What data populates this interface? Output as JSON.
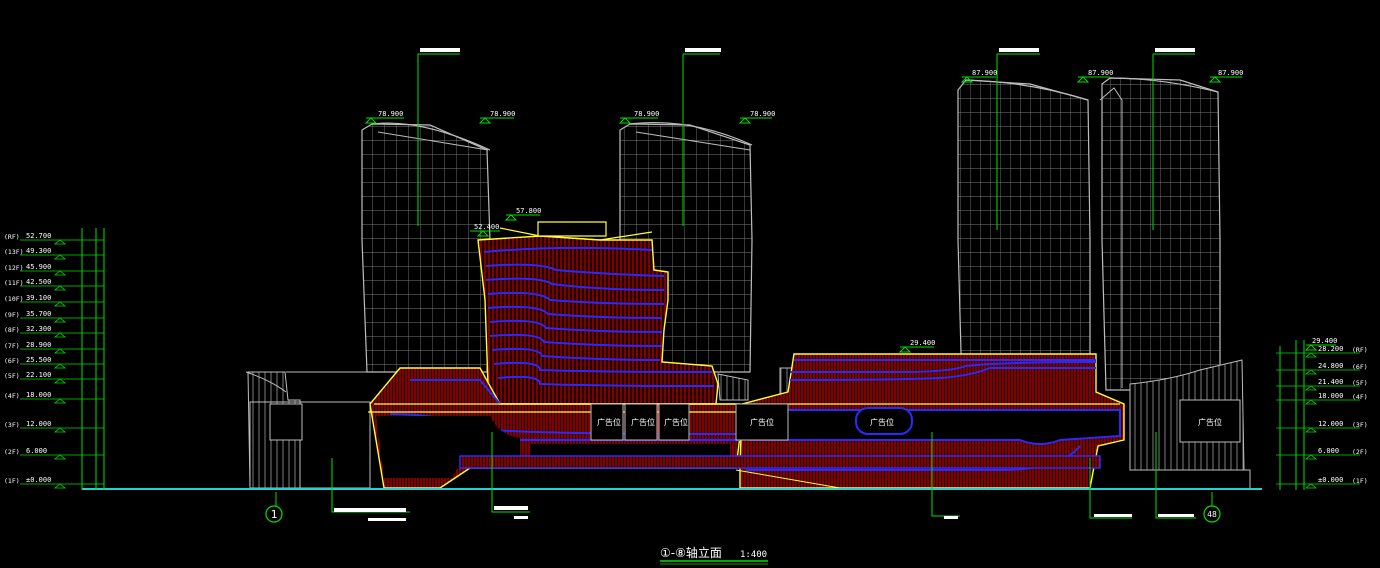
{
  "drawing": {
    "title": "①-⑧轴立面",
    "scale": "1:400",
    "grid_left": "1",
    "grid_right": "48"
  },
  "left_levels": [
    {
      "floor": "(RF)",
      "elev": "52.700"
    },
    {
      "floor": "(13F)",
      "elev": "49.300"
    },
    {
      "floor": "(12F)",
      "elev": "45.900"
    },
    {
      "floor": "(11F)",
      "elev": "42.500"
    },
    {
      "floor": "(10F)",
      "elev": "39.100"
    },
    {
      "floor": "(9F)",
      "elev": "35.700"
    },
    {
      "floor": "(8F)",
      "elev": "32.300"
    },
    {
      "floor": "(7F)",
      "elev": "28.900"
    },
    {
      "floor": "(6F)",
      "elev": "25.500"
    },
    {
      "floor": "(5F)",
      "elev": "22.100"
    },
    {
      "floor": "(4F)",
      "elev": "18.000"
    },
    {
      "floor": "(3F)",
      "elev": "12.000"
    },
    {
      "floor": "(2F)",
      "elev": "6.000"
    },
    {
      "floor": "(1F)",
      "elev": "±0.000"
    }
  ],
  "right_levels": [
    {
      "floor": "(RF)",
      "elev": "28.200"
    },
    {
      "floor": "(6F)",
      "elev": "24.800"
    },
    {
      "floor": "(5F)",
      "elev": "21.400"
    },
    {
      "floor": "(4F)",
      "elev": "18.000"
    },
    {
      "floor": "(3F)",
      "elev": "12.000"
    },
    {
      "floor": "(2F)",
      "elev": "6.000"
    },
    {
      "floor": "(1F)",
      "elev": "±0.000"
    }
  ],
  "top_elevations": {
    "tower1_left": "78.900",
    "tower1_right": "78.900",
    "tower2_left": "78.900",
    "tower2_right": "78.900",
    "tower3_left": "87.900",
    "tower3_mid": "87.900",
    "tower3_right": "87.900",
    "podium_roof": "57.800",
    "podium_parapet": "52.400",
    "right_podium": "29.400",
    "right_top": "29.400"
  },
  "shop_labels": [
    "广告位",
    "广告位",
    "广告位",
    "广告位",
    "广告位",
    "广告位"
  ]
}
